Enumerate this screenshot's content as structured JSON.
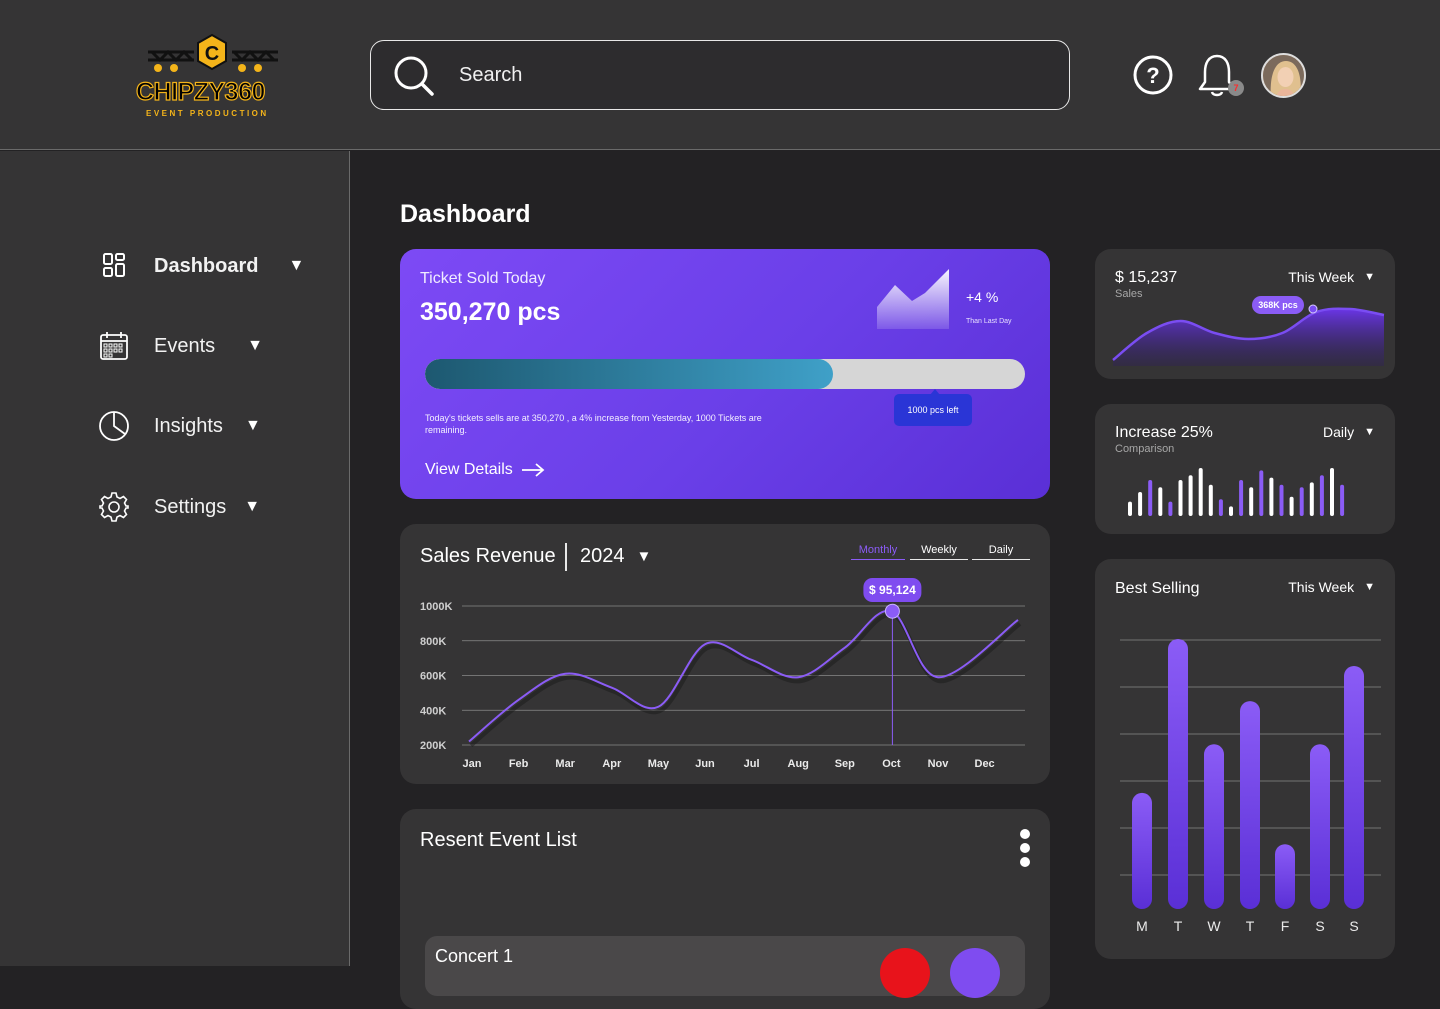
{
  "brand": {
    "name": "CHIPZY360",
    "tagline": "EVENT PRODUCTION",
    "letter": "C",
    "accent": "#f4b41a"
  },
  "search": {
    "placeholder": "Search"
  },
  "header": {
    "notification_count": "7",
    "icons": [
      "help-icon",
      "bell-icon",
      "avatar"
    ]
  },
  "sidebar": {
    "items": [
      {
        "label": "Dashboard",
        "icon": "dashboard-icon",
        "active": true
      },
      {
        "label": "Events",
        "icon": "calendar-icon"
      },
      {
        "label": "Insights",
        "icon": "pie-chart-icon"
      },
      {
        "label": "Settings",
        "icon": "gear-icon"
      }
    ],
    "caret": "▼"
  },
  "page": {
    "title": "Dashboard"
  },
  "ticket": {
    "title": "Ticket Sold Today",
    "value": "350,270 pcs",
    "change": "+4 %",
    "change_sub": "Than Last Day",
    "progress": 0.68,
    "remaining": "1000 pcs left",
    "description": "Today's tickets sells are at 350,270 , a 4% increase from Yesterday, 1000 Tickets are remaining.",
    "cta": "View Details"
  },
  "sales_revenue": {
    "title": "Sales Revenue",
    "year": "2024",
    "caret": "▼",
    "tabs": [
      {
        "label": "Monthly",
        "active": true
      },
      {
        "label": "Weekly"
      },
      {
        "label": "Daily"
      }
    ],
    "highlight": "$ 95,124"
  },
  "chart_data": {
    "type": "line",
    "categories": [
      "Jan",
      "Feb",
      "Mar",
      "Apr",
      "May",
      "Jun",
      "Jul",
      "Aug",
      "Sep",
      "Oct",
      "Nov",
      "Dec"
    ],
    "series": [
      {
        "values": [
          220000,
          460000,
          610000,
          530000,
          420000,
          780000,
          690000,
          590000,
          760000,
          970000,
          590000,
          920000
        ]
      }
    ],
    "yticks": [
      "1000K",
      "800K",
      "600K",
      "400K",
      "200K"
    ],
    "ylim": [
      200000,
      1000000
    ],
    "highlight_index": 9,
    "grid": true,
    "color": "#8b5cf6"
  },
  "events": {
    "title": "Resent Event List",
    "rows": [
      {
        "name": "Concert 1"
      }
    ]
  },
  "sales_card": {
    "value": "$ 15,237",
    "label": "Sales",
    "period": "This Week",
    "pill": "368K pcs",
    "wave": [
      0.1,
      0.55,
      0.75,
      0.55,
      0.45,
      0.55,
      0.9,
      0.95,
      0.85
    ]
  },
  "comparison_card": {
    "value": "Increase 25%",
    "label": "Comparison",
    "period": "Daily",
    "bars": [
      {
        "v": 0.3,
        "c": "w"
      },
      {
        "v": 0.5,
        "c": "w"
      },
      {
        "v": 0.75,
        "c": "p"
      },
      {
        "v": 0.6,
        "c": "w"
      },
      {
        "v": 0.3,
        "c": "p"
      },
      {
        "v": 0.75,
        "c": "w"
      },
      {
        "v": 0.85,
        "c": "w"
      },
      {
        "v": 1.0,
        "c": "w"
      },
      {
        "v": 0.65,
        "c": "w"
      },
      {
        "v": 0.35,
        "c": "p"
      },
      {
        "v": 0.2,
        "c": "w"
      },
      {
        "v": 0.75,
        "c": "p"
      },
      {
        "v": 0.6,
        "c": "w"
      },
      {
        "v": 0.95,
        "c": "p"
      },
      {
        "v": 0.8,
        "c": "w"
      },
      {
        "v": 0.65,
        "c": "p"
      },
      {
        "v": 0.4,
        "c": "w"
      },
      {
        "v": 0.6,
        "c": "p"
      },
      {
        "v": 0.7,
        "c": "w"
      },
      {
        "v": 0.85,
        "c": "p"
      },
      {
        "v": 1.0,
        "c": "w"
      },
      {
        "v": 0.65,
        "c": "p"
      }
    ]
  },
  "best_selling": {
    "title": "Best Selling",
    "period": "This Week",
    "days": [
      "M",
      "T",
      "W",
      "T",
      "F",
      "S",
      "S"
    ],
    "values": [
      0.43,
      1.0,
      0.61,
      0.77,
      0.24,
      0.61,
      0.9
    ]
  }
}
